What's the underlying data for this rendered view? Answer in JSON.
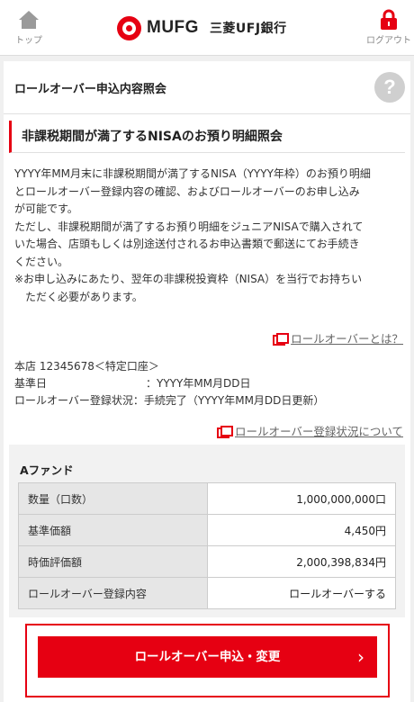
{
  "header": {
    "home_label": "トップ",
    "logo_en": "MUFG",
    "logo_jp": "三菱UFJ銀行",
    "logout_label": "ログアウト",
    "colors": {
      "brand_red": "#e60012",
      "icon_gray": "#9a9a9a"
    }
  },
  "page": {
    "title": "ロールオーバー申込内容照会",
    "help_label": "?",
    "section_title": "非課税期間が満了するNISAのお預り明細照会"
  },
  "description": {
    "line1": "YYYY年MM月末に非課税期間が満了するNISA（YYYY年枠）のお預り明細",
    "line2": "とロールオーバー登録内容の確認、およびロールオーバーのお申し込み",
    "line3": "が可能です。",
    "line4": "ただし、非課税期間が満了するお預り明細をジュニアNISAで購入されて",
    "line5": "いた場合、店頭もしくは別途送付されるお申込書類で郵送にてお手続き",
    "line6": "ください。",
    "line7": "※お申し込みにあたり、翌年の非課税投資枠（NISA）を当行でお持ちい",
    "line8": "ただく必要があります。"
  },
  "links": {
    "rollover_about": "ロールオーバーとは？",
    "rollover_status": "ロールオーバー登録状況について"
  },
  "account": {
    "branch_line": "本店 12345678＜特定口座＞",
    "base_date_label": "基準日",
    "base_date_value": "：YYYY年MM月DD日",
    "status_label": "ロールオーバー登録状況",
    "status_value": "：手続完了（YYYY年MM月DD日更新）"
  },
  "fund": {
    "name": "Aファンド",
    "rows": [
      {
        "label": "数量（口数）",
        "value": "1,000,000,000口"
      },
      {
        "label": "基準価額",
        "value": "4,450円"
      },
      {
        "label": "時価評価額",
        "value": "2,000,398,834円"
      },
      {
        "label": "ロールオーバー登録内容",
        "value": "ロールオーバーする"
      }
    ]
  },
  "cta": {
    "label": "ロールオーバー申込・変更",
    "chevron": "›"
  }
}
